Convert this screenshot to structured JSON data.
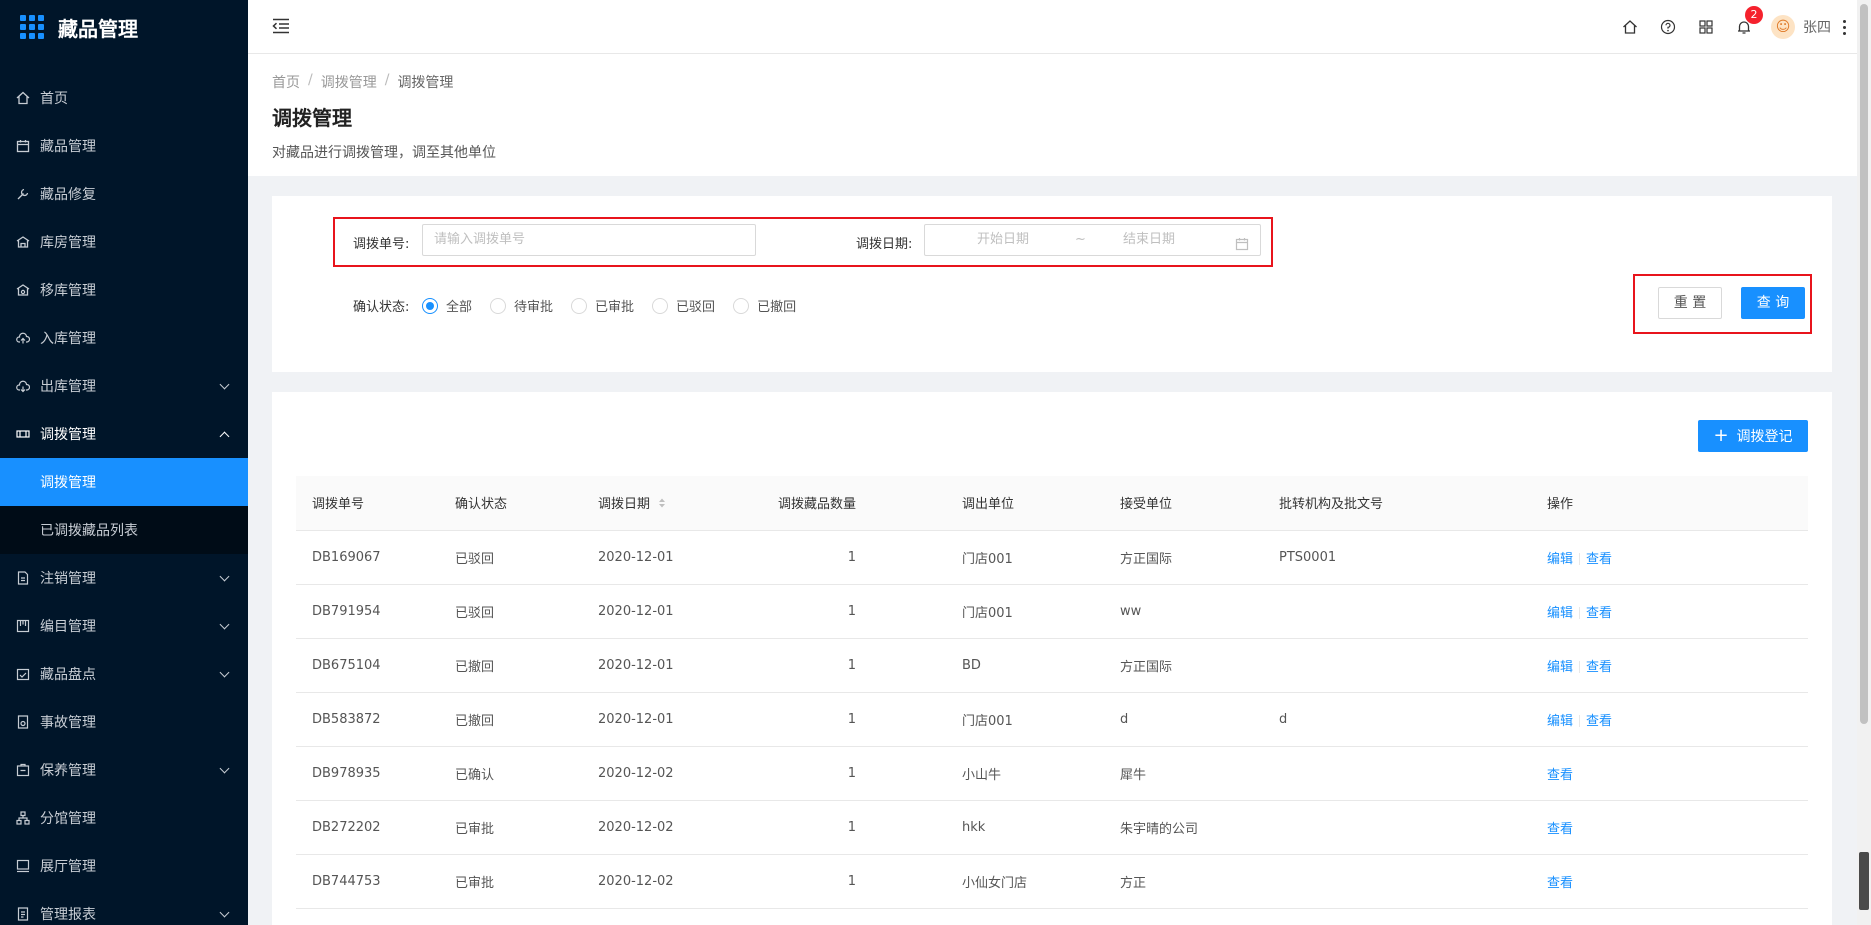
{
  "app": {
    "title": "藏品管理"
  },
  "sidebar": {
    "items": [
      {
        "label": "首页",
        "icon": "home-icon"
      },
      {
        "label": "藏品管理",
        "icon": "calendar-icon"
      },
      {
        "label": "藏品修复",
        "icon": "wrench-icon"
      },
      {
        "label": "库房管理",
        "icon": "warehouse-icon"
      },
      {
        "label": "移库管理",
        "icon": "move-icon"
      },
      {
        "label": "入库管理",
        "icon": "upload-cloud-icon"
      },
      {
        "label": "出库管理",
        "icon": "download-cloud-icon"
      },
      {
        "label": "调拨管理",
        "icon": "transfer-icon"
      }
    ],
    "submenu": [
      {
        "label": "调拨管理"
      },
      {
        "label": "已调拨藏品列表"
      }
    ],
    "items_after": [
      {
        "label": "注销管理",
        "icon": "file-icon"
      },
      {
        "label": "编目管理",
        "icon": "catalog-icon"
      },
      {
        "label": "藏品盘点",
        "icon": "inventory-icon"
      },
      {
        "label": "事故管理",
        "icon": "accident-icon"
      },
      {
        "label": "保养管理",
        "icon": "maintenance-icon"
      },
      {
        "label": "分馆管理",
        "icon": "branch-icon"
      },
      {
        "label": "展厅管理",
        "icon": "hall-icon"
      },
      {
        "label": "管理报表",
        "icon": "report-icon"
      }
    ]
  },
  "header": {
    "notification_count": "2",
    "username": "张四"
  },
  "breadcrumb": [
    "首页",
    "调拨管理",
    "调拨管理"
  ],
  "page": {
    "title": "调拨管理",
    "description": "对藏品进行调拨管理，调至其他单位"
  },
  "search": {
    "order_label": "调拨单号:",
    "order_placeholder": "请输入调拨单号",
    "date_label": "调拨日期:",
    "start_placeholder": "开始日期",
    "range_sep": "~",
    "end_placeholder": "结束日期",
    "status_label": "确认状态:",
    "status_options": [
      "全部",
      "待审批",
      "已审批",
      "已驳回",
      "已撤回"
    ],
    "reset_label": "重 置",
    "query_label": "查 询"
  },
  "table": {
    "add_label": "调拨登记",
    "columns": [
      "调拨单号",
      "确认状态",
      "调拨日期",
      "调拨藏品数量",
      "调出单位",
      "接受单位",
      "批转机构及批文号",
      "操作"
    ],
    "rows": [
      {
        "id": "DB169067",
        "status": "已驳回",
        "date": "2020-12-01",
        "count": "1",
        "from": "门店001",
        "to": "方正国际",
        "approval": "PTS0001",
        "edit": "编辑",
        "view": "查看"
      },
      {
        "id": "DB791954",
        "status": "已驳回",
        "date": "2020-12-01",
        "count": "1",
        "from": "门店001",
        "to": "ww",
        "approval": "",
        "edit": "编辑",
        "view": "查看"
      },
      {
        "id": "DB675104",
        "status": "已撤回",
        "date": "2020-12-01",
        "count": "1",
        "from": "BD",
        "to": "方正国际",
        "approval": "",
        "edit": "编辑",
        "view": "查看"
      },
      {
        "id": "DB583872",
        "status": "已撤回",
        "date": "2020-12-01",
        "count": "1",
        "from": "门店001",
        "to": "d",
        "approval": "d",
        "edit": "编辑",
        "view": "查看"
      },
      {
        "id": "DB978935",
        "status": "已确认",
        "date": "2020-12-02",
        "count": "1",
        "from": "小山牛",
        "to": "犀牛",
        "approval": "",
        "edit": "",
        "view": "查看"
      },
      {
        "id": "DB272202",
        "status": "已审批",
        "date": "2020-12-02",
        "count": "1",
        "from": "hkk",
        "to": "朱宇晴的公司",
        "approval": "",
        "edit": "",
        "view": "查看"
      },
      {
        "id": "DB744753",
        "status": "已审批",
        "date": "2020-12-02",
        "count": "1",
        "from": "小仙女门店",
        "to": "方正",
        "approval": "",
        "edit": "",
        "view": "查看"
      }
    ]
  },
  "colors": {
    "primary": "#1890ff",
    "sidebar_bg": "#001529",
    "highlight": "#e8141c"
  }
}
